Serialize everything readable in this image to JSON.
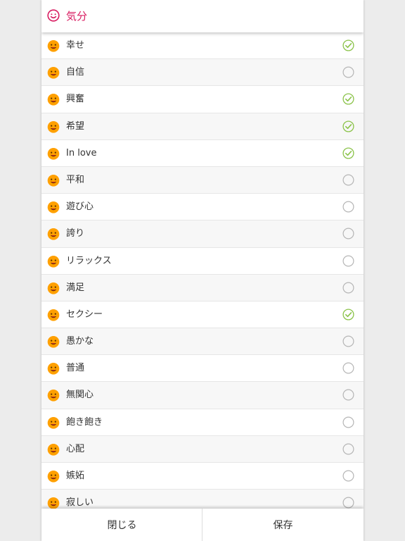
{
  "header": {
    "title": "気分",
    "icon": "smiley-icon",
    "accent": "#d81b60"
  },
  "moods": [
    {
      "label": "幸せ",
      "icon": "happy-face-icon",
      "checked": true
    },
    {
      "label": "自信",
      "icon": "cool-face-icon",
      "checked": false
    },
    {
      "label": "興奮",
      "icon": "excited-face-icon",
      "checked": true
    },
    {
      "label": "希望",
      "icon": "hopeful-face-icon",
      "checked": true
    },
    {
      "label": "In love",
      "icon": "heart-eyes-face-icon",
      "checked": true
    },
    {
      "label": "平和",
      "icon": "angel-face-icon",
      "checked": false
    },
    {
      "label": "遊び心",
      "icon": "playful-face-icon",
      "checked": false
    },
    {
      "label": "誇り",
      "icon": "proud-face-icon",
      "checked": false
    },
    {
      "label": "リラックス",
      "icon": "relaxed-face-icon",
      "checked": false
    },
    {
      "label": "満足",
      "icon": "satisfied-face-icon",
      "checked": false
    },
    {
      "label": "セクシー",
      "icon": "sexy-face-icon",
      "checked": true
    },
    {
      "label": "愚かな",
      "icon": "silly-face-icon",
      "checked": false
    },
    {
      "label": "普通",
      "icon": "neutral-face-icon",
      "checked": false
    },
    {
      "label": "無関心",
      "icon": "indifferent-face-icon",
      "checked": false
    },
    {
      "label": "飽き飽き",
      "icon": "bored-face-icon",
      "checked": false
    },
    {
      "label": "心配",
      "icon": "worried-face-icon",
      "checked": false
    },
    {
      "label": "嫉妬",
      "icon": "jealous-face-icon",
      "checked": false
    },
    {
      "label": "寂しい",
      "icon": "lonely-face-icon",
      "checked": false
    }
  ],
  "footer": {
    "close_label": "閉じる",
    "save_label": "保存"
  },
  "colors": {
    "check": "#8bc34a",
    "unchecked": "#b5b5b5",
    "emoji": "#ffa000"
  }
}
